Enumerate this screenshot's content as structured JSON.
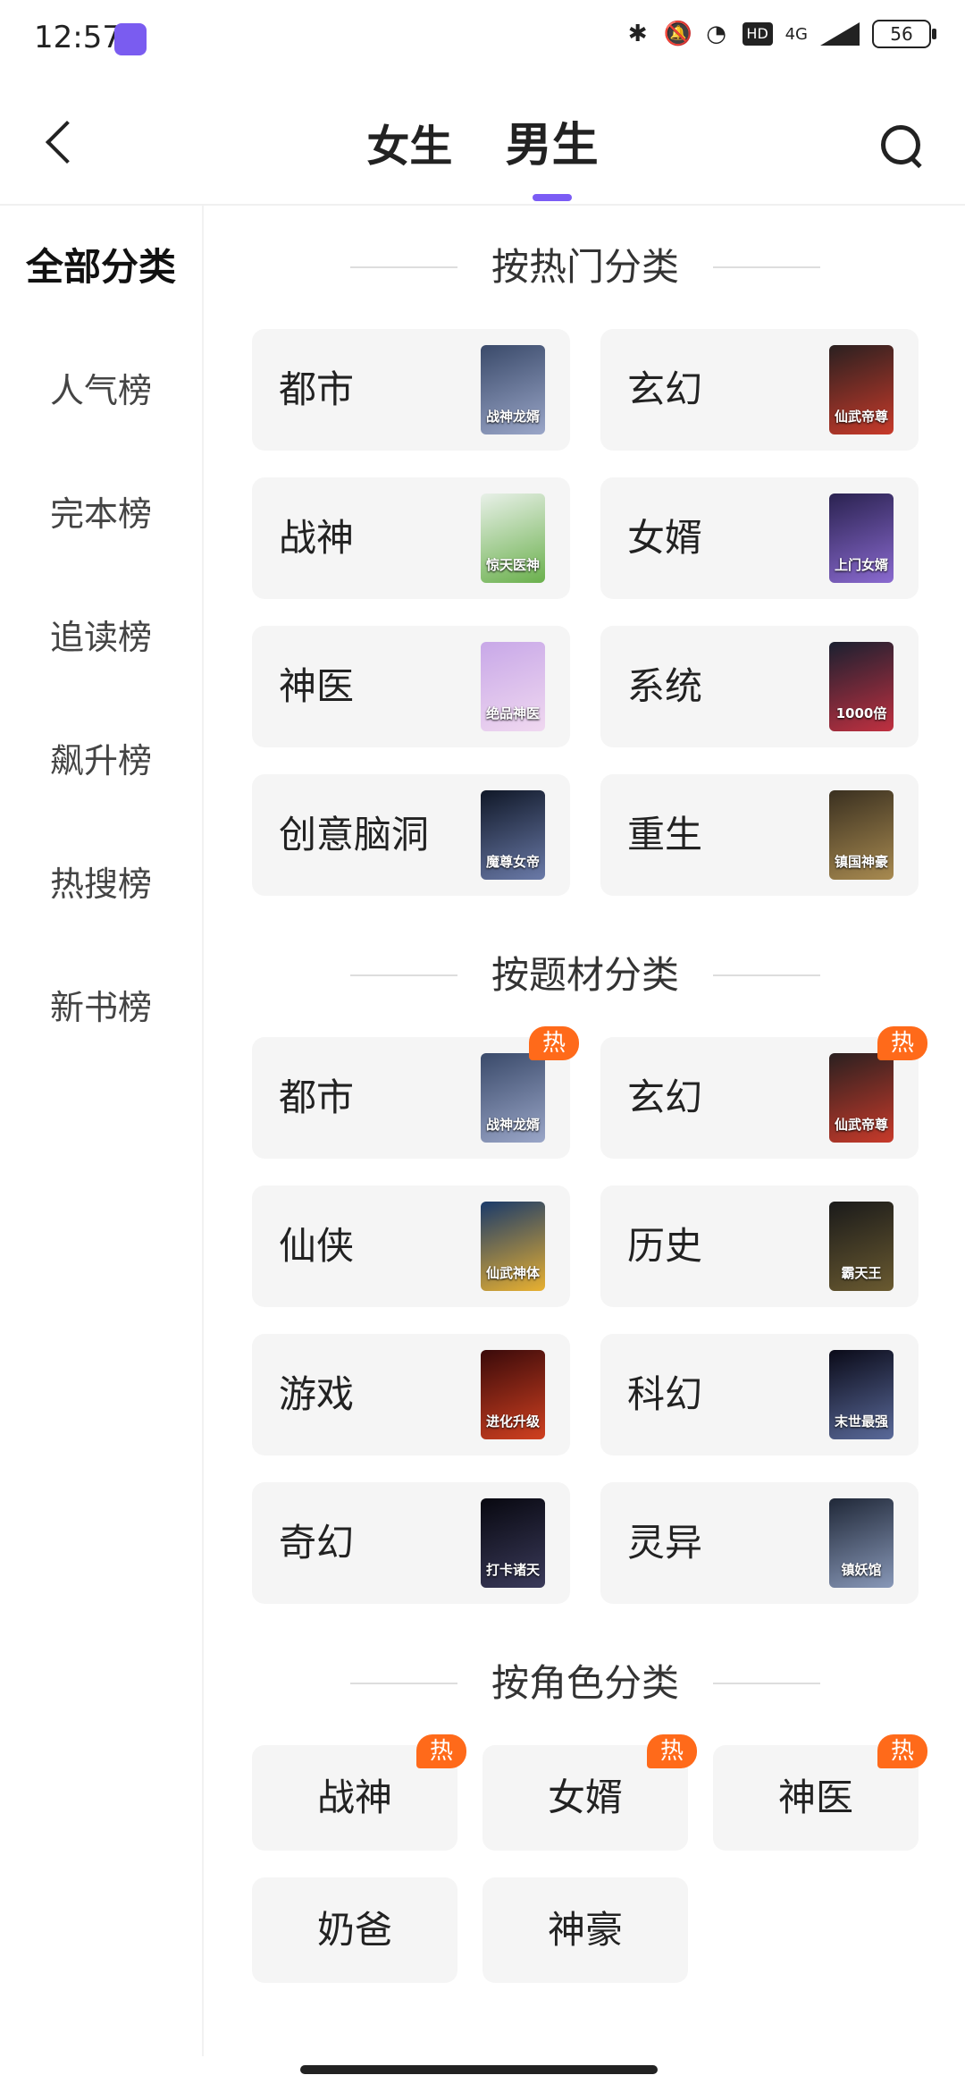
{
  "status_bar": {
    "time": "12:57",
    "network": "4G",
    "battery": "56",
    "hd": "HD"
  },
  "header": {
    "tabs": [
      {
        "label": "女生"
      },
      {
        "label": "男生"
      }
    ],
    "active_tab": "男生"
  },
  "sidebar": {
    "items": [
      {
        "label": "全部分类"
      },
      {
        "label": "人气榜"
      },
      {
        "label": "完本榜"
      },
      {
        "label": "追读榜"
      },
      {
        "label": "飙升榜"
      },
      {
        "label": "热搜榜"
      },
      {
        "label": "新书榜"
      }
    ]
  },
  "sections": {
    "hot": {
      "title": "按热门分类",
      "items": [
        {
          "label": "都市",
          "cover_text": "战神龙婿",
          "colors": [
            "#3a4a6a",
            "#9aa6c8"
          ]
        },
        {
          "label": "玄幻",
          "cover_text": "仙武帝尊",
          "colors": [
            "#2a2020",
            "#c83a2a"
          ]
        },
        {
          "label": "战神",
          "cover_text": "惊天医神",
          "colors": [
            "#e8f0e8",
            "#6ab04c"
          ]
        },
        {
          "label": "女婿",
          "cover_text": "上门女婿",
          "colors": [
            "#2a2250",
            "#8a6ad0"
          ]
        },
        {
          "label": "神医",
          "cover_text": "绝品神医",
          "colors": [
            "#c8a8e8",
            "#f0d8f0"
          ]
        },
        {
          "label": "系统",
          "cover_text": "1000倍",
          "colors": [
            "#1a2030",
            "#c03040"
          ]
        },
        {
          "label": "创意脑洞",
          "cover_text": "魔尊女帝",
          "colors": [
            "#101828",
            "#6a7aa8"
          ]
        },
        {
          "label": "重生",
          "cover_text": "镇国神豪",
          "colors": [
            "#3a3020",
            "#a88a50"
          ]
        }
      ]
    },
    "theme": {
      "title": "按题材分类",
      "hot_badge": "热",
      "items": [
        {
          "label": "都市",
          "cover_text": "战神龙婿",
          "colors": [
            "#3a4a6a",
            "#9aa6c8"
          ],
          "hot": true
        },
        {
          "label": "玄幻",
          "cover_text": "仙武帝尊",
          "colors": [
            "#2a2020",
            "#c83a2a"
          ],
          "hot": true
        },
        {
          "label": "仙侠",
          "cover_text": "仙武神体",
          "colors": [
            "#1a3a6a",
            "#e8b030"
          ]
        },
        {
          "label": "历史",
          "cover_text": "霸天王",
          "colors": [
            "#1a1a1a",
            "#6a5a30"
          ]
        },
        {
          "label": "游戏",
          "cover_text": "进化升级",
          "colors": [
            "#3a0a0a",
            "#d04020"
          ]
        },
        {
          "label": "科幻",
          "cover_text": "末世最强",
          "colors": [
            "#0a0a18",
            "#5a6a9a"
          ]
        },
        {
          "label": "奇幻",
          "cover_text": "打卡诸天",
          "colors": [
            "#080810",
            "#3a3a5a"
          ]
        },
        {
          "label": "灵异",
          "cover_text": "镇妖馆",
          "colors": [
            "#202838",
            "#8898b8"
          ]
        }
      ]
    },
    "role": {
      "title": "按角色分类",
      "hot_badge": "热",
      "items": [
        {
          "label": "战神",
          "hot": true
        },
        {
          "label": "女婿",
          "hot": true
        },
        {
          "label": "神医",
          "hot": true
        },
        {
          "label": "奶爸"
        },
        {
          "label": "神豪"
        }
      ]
    }
  }
}
